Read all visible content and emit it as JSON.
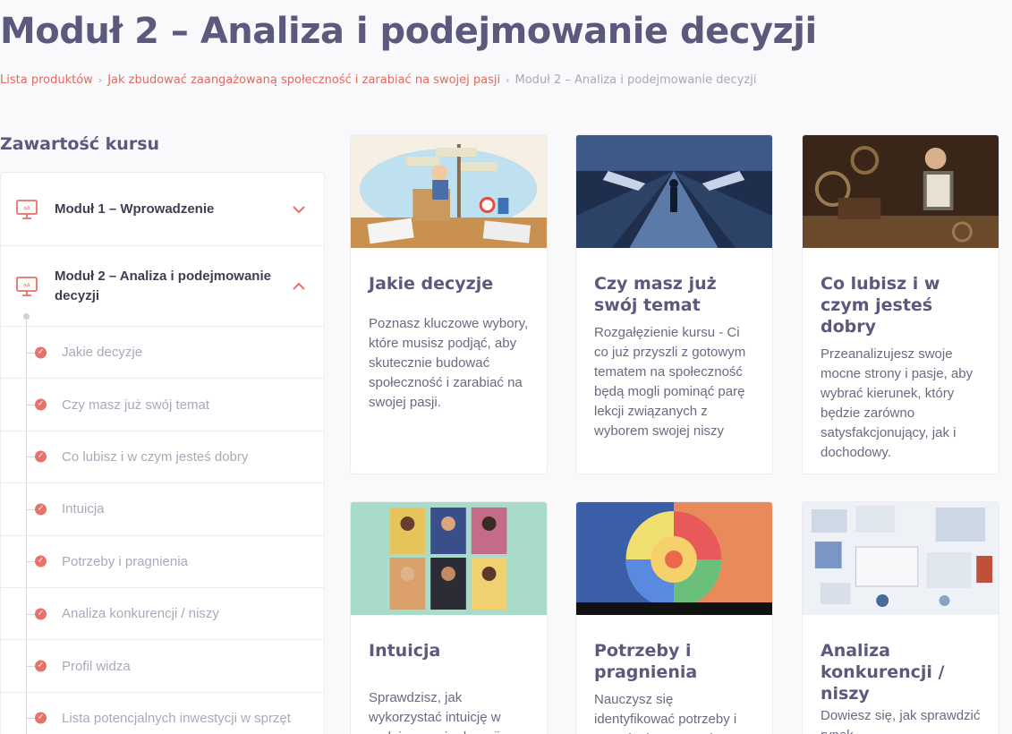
{
  "page_title": "Moduł 2 – Analiza i podejmowanie decyzji",
  "breadcrumb": {
    "items": [
      "Lista produktów",
      "Jak zbudować zaangażowaną społeczność i zarabiać na swojej pasji"
    ],
    "separator": "›",
    "current": "Moduł 2 – Analiza i podejmowanie decyzji"
  },
  "sidebar": {
    "heading": "Zawartość kursu",
    "modules": [
      {
        "label": "Moduł 1 – Wprowadzenie",
        "expanded": false,
        "icon": "presentation-icon"
      },
      {
        "label": "Moduł 2 – Analiza i podejmowanie decyzji",
        "expanded": true,
        "icon": "presentation-icon"
      }
    ],
    "lessons": [
      "Jakie decyzje",
      "Czy masz już swój temat",
      "Co lubisz i w czym jesteś dobry",
      "Intuicja",
      "Potrzeby i pragnienia",
      "Analiza konkurencji / niszy",
      "Profil widza",
      "Lista potencjalnych inwestycji w sprzęt"
    ],
    "check_glyph": "✓"
  },
  "cards": [
    {
      "title": "Jakie decyzje",
      "desc": "Poznasz kluczowe wybory, które musisz podjąć, aby skutecznie budować społeczność i zarabiać na swojej pasji."
    },
    {
      "title": "Czy masz już swój temat",
      "desc": "Rozgałęzienie kursu - Ci co już przyszli z gotowym tematem na społeczność będą mogli pominąć parę lekcji związanych z wyborem swojej niszy"
    },
    {
      "title": "Co lubisz i w czym jesteś dobry",
      "desc": "Przeanalizujesz swoje mocne strony i pasje, aby wybrać kierunek, który będzie zarówno satysfakcjonujący, jak i dochodowy."
    },
    {
      "title": "Intuicja",
      "desc": "Sprawdzisz, jak wykorzystać intuicję w podejmowaniu decyzji"
    },
    {
      "title": "Potrzeby i pragnienia",
      "desc": "Nauczysz się identyfikować potrzeby i pragnienia. Zrozumiesz"
    },
    {
      "title": "Analiza konkurencji / niszy",
      "desc": "Dowiesz się, jak sprawdzić rynek"
    }
  ],
  "colors": {
    "accent": "#e06a5e",
    "title": "#5b5a7c",
    "muted": "#a9a9ba",
    "background": "#f9f9fc"
  }
}
